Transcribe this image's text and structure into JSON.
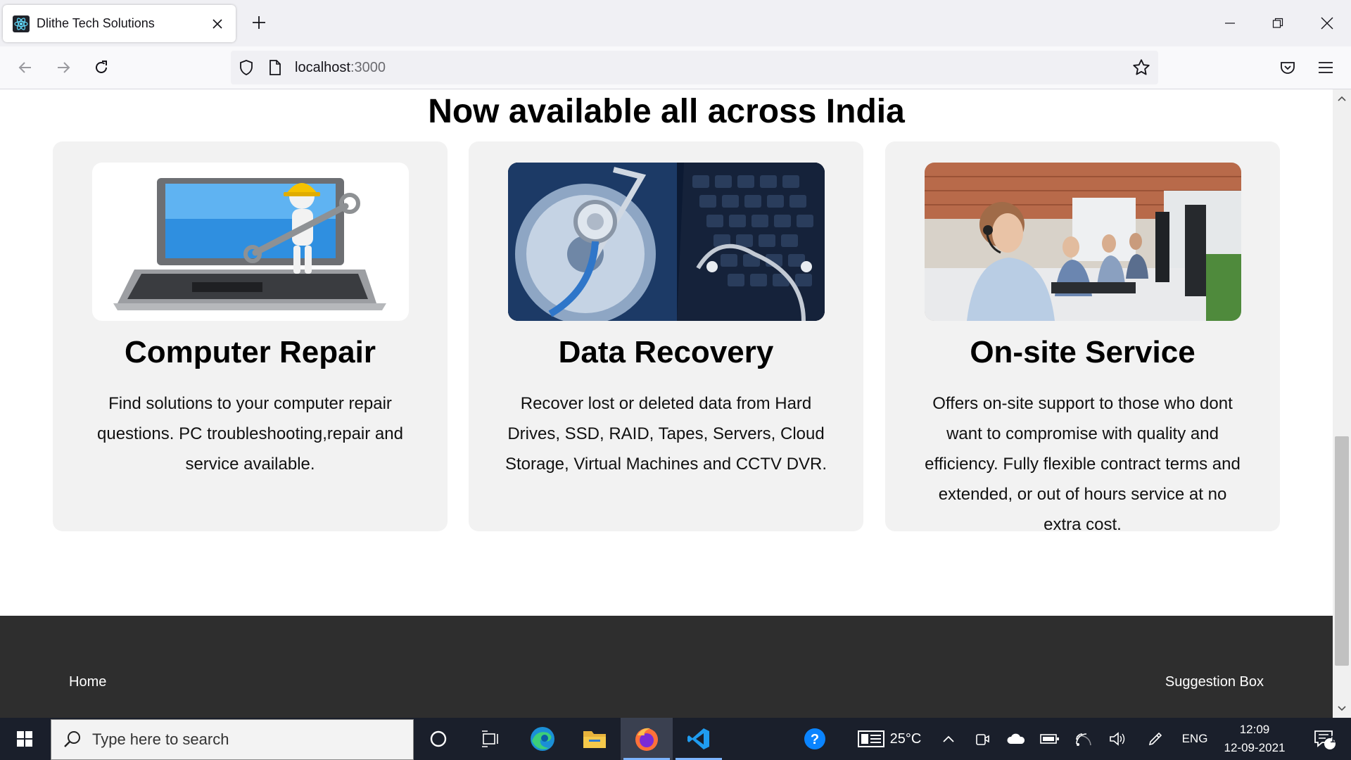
{
  "browser": {
    "tab_title": "Dlithe Tech Solutions",
    "url_host": "localhost",
    "url_port": ":3000"
  },
  "page": {
    "heading": "Now available all across India",
    "cards": [
      {
        "title": "Computer Repair",
        "text": "Find solutions to your computer repair questions. PC troubleshooting,repair and service available."
      },
      {
        "title": "Data Recovery",
        "text": "Recover lost or deleted data from Hard Drives, SSD, RAID, Tapes, Servers, Cloud Storage, Virtual Machines and CCTV DVR."
      },
      {
        "title": "On-site Service",
        "text": "Offers on-site support to those who dont want to compromise with quality and efficiency. Fully flexible contract terms and extended, or out of hours service at no extra cost."
      }
    ],
    "footer": {
      "home": "Home",
      "suggestion": "Suggestion Box"
    }
  },
  "taskbar": {
    "search_placeholder": "Type here to search",
    "temperature": "25°C",
    "language": "ENG",
    "time": "12:09",
    "date": "12-09-2021",
    "notification_count": "1"
  },
  "colors": {
    "footer_bg": "#2e2e2e",
    "card_bg": "#f2f2f2",
    "taskbar_bg": "#1a1f2b"
  }
}
